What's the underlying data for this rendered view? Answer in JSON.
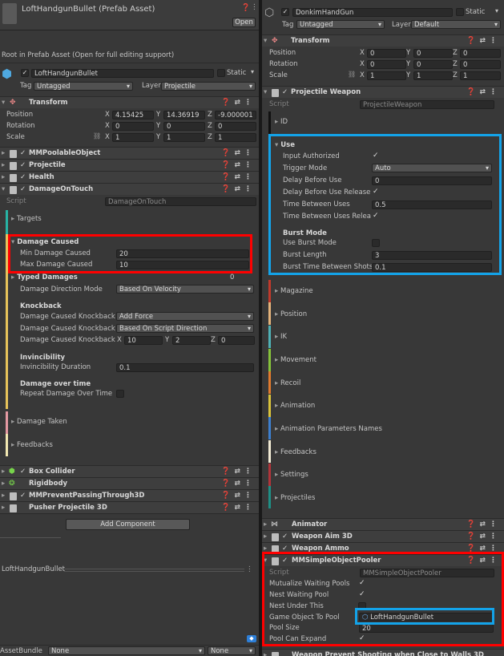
{
  "left": {
    "prefab_title": "LoftHandgunBullet (Prefab Asset)",
    "open_button": "Open",
    "notice": "Root in Prefab Asset (Open for full editing support)",
    "object_name": "LoftHandgunBullet",
    "static_label": "Static",
    "tag_label": "Tag",
    "tag_value": "Untagged",
    "layer_label": "Layer",
    "layer_value": "Projectile",
    "transform": {
      "title": "Transform",
      "position": "Position",
      "rotation": "Rotation",
      "scale": "Scale",
      "pos": [
        "4.15425",
        "14.36919",
        "-9.000001"
      ],
      "rot": [
        "0",
        "0",
        "0"
      ],
      "scl": [
        "1",
        "1",
        "1"
      ]
    },
    "components_top": [
      "MMPoolableObject",
      "Projectile",
      "Health",
      "DamageOnTouch"
    ],
    "script_label": "Script",
    "script_value": "DamageOnTouch",
    "targets": "Targets",
    "damage_caused": "Damage Caused",
    "min_damage_label": "Min Damage Caused",
    "min_damage_value": "20",
    "max_damage_label": "Max Damage Caused",
    "max_damage_value": "10",
    "typed_damages": "Typed Damages",
    "typed_damages_count": "0",
    "direction_mode_label": "Damage Direction Mode",
    "direction_mode_value": "Based On Velocity",
    "knockback": "Knockback",
    "kb_type_label": "Damage Caused Knockback Ty",
    "kb_type_value": "Add Force",
    "kb_dir_label": "Damage Caused Knockback Di",
    "kb_dir_value": "Based On Script Direction",
    "kb_force_label": "Damage Caused Knockback Fo",
    "kb_force": [
      "10",
      "2",
      "0"
    ],
    "invincibility": "Invincibility",
    "inv_duration_label": "Invincibility Duration",
    "inv_duration_value": "0.1",
    "dot": "Damage over time",
    "repeat_label": "Repeat Damage Over Time",
    "damage_taken": "Damage Taken",
    "feedbacks": "Feedbacks",
    "components_bottom": [
      "Box Collider",
      "Rigidbody",
      "MMPreventPassingThrough3D",
      "Pusher Projectile 3D"
    ],
    "add_component": "Add Component",
    "preview_title": "LoftHandgunBullet",
    "assetbundle_label": "AssetBundle",
    "assetbundle_value": "None",
    "variant_value": "None"
  },
  "right": {
    "object_name": "DonkimHandGun",
    "static_label": "Static",
    "tag_label": "Tag",
    "tag_value": "Untagged",
    "layer_label": "Layer",
    "layer_value": "Default",
    "transform": {
      "title": "Transform",
      "position": "Position",
      "rotation": "Rotation",
      "scale": "Scale",
      "pos": [
        "0",
        "0",
        "0"
      ],
      "rot": [
        "0",
        "0",
        "0"
      ],
      "scl": [
        "1",
        "1",
        "1"
      ]
    },
    "projectile_weapon": "Projectile Weapon",
    "script_label": "Script",
    "script_value": "ProjectileWeapon",
    "id": "ID",
    "use": "Use",
    "input_authorized": "Input Authorized",
    "trigger_mode_label": "Trigger Mode",
    "trigger_mode_value": "Auto",
    "delay_before_use_label": "Delay Before Use",
    "delay_before_use_value": "0",
    "delay_release_label": "Delay Before Use Release Int",
    "time_between_label": "Time Between Uses",
    "time_between_value": "0.5",
    "time_between_release_label": "Time Between Uses Release",
    "burst_mode": "Burst Mode",
    "use_burst_label": "Use Burst Mode",
    "burst_length_label": "Burst Length",
    "burst_length_value": "3",
    "burst_time_label": "Burst Time Between Shots",
    "burst_time_value": "0.1",
    "sections": [
      "Magazine",
      "Position",
      "IK",
      "Movement",
      "Recoil",
      "Animation",
      "Animation Parameters Names",
      "Feedbacks",
      "Settings",
      "Projectiles"
    ],
    "components": [
      "Animator",
      "Weapon Aim 3D",
      "Weapon Ammo",
      "MMSimpleObjectPooler"
    ],
    "pooler_script_value": "MMSimpleObjectPooler",
    "mutualize_label": "Mutualize Waiting Pools",
    "nest_label": "Nest Waiting Pool",
    "nest_under_label": "Nest Under This",
    "go_to_pool_label": "Game Object To Pool",
    "go_to_pool_value": "LoftHandgunBullet",
    "pool_size_label": "Pool Size",
    "pool_size_value": "20",
    "pool_expand_label": "Pool Can Expand",
    "last_component": "Weapon Prevent Shooting when Close to Walls 3D"
  },
  "colors": {
    "highlight_red": "#ff0000",
    "highlight_blue": "#13a3e9"
  }
}
